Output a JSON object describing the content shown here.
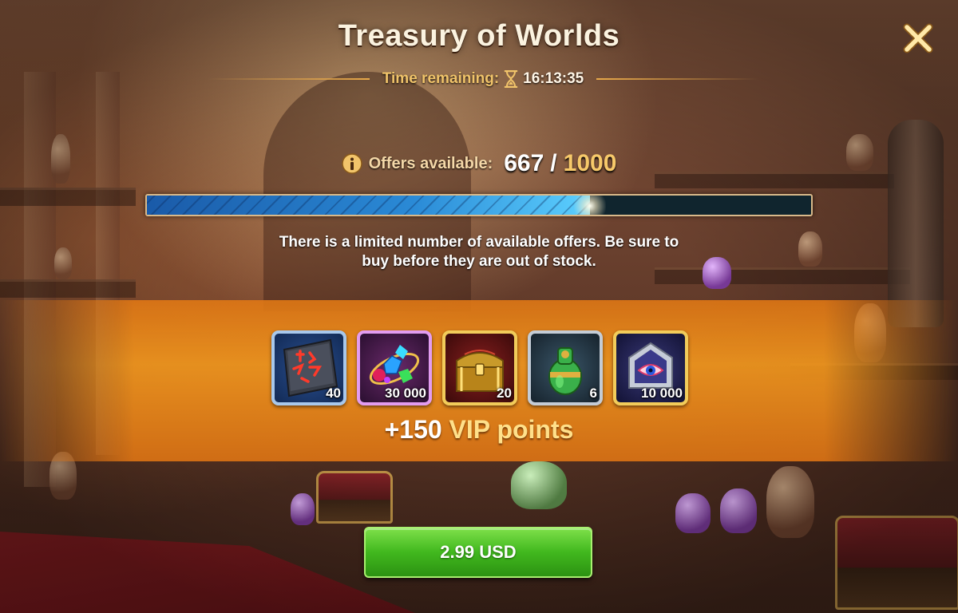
{
  "window": {
    "title": "Treasury of Worlds",
    "close_icon": "close-icon"
  },
  "timer": {
    "label": "Time remaining:",
    "icon": "hourglass-icon",
    "value": "16:13:35"
  },
  "offers": {
    "icon": "info-icon",
    "label": "Offers available:",
    "current": "667",
    "separator": "/",
    "total": "1000",
    "progress_fraction": 0.667,
    "notice": "There is a limited number of available offers. Be sure to buy before they are out of stock."
  },
  "rewards": [
    {
      "icon": "rune-tablet-icon",
      "quantity": "40",
      "frame": "blue"
    },
    {
      "icon": "gem-cluster-icon",
      "quantity": "30 000",
      "frame": "purple"
    },
    {
      "icon": "treasure-chest-icon",
      "quantity": "20",
      "frame": "gold"
    },
    {
      "icon": "green-armor-orb-icon",
      "quantity": "6",
      "frame": "silver"
    },
    {
      "icon": "eye-emblem-icon",
      "quantity": "10 000",
      "frame": "gold"
    }
  ],
  "vip": {
    "amount": "+150",
    "label": "VIP points"
  },
  "buy_button": {
    "label": "2.99 USD"
  },
  "colors": {
    "title_text": "#fbf3e0",
    "timer_label": "#f1c46a",
    "offers_total": "#f7c96a",
    "banner_orange": "#e8861c",
    "vip_label": "#ffe08a",
    "button_green": "#41b81e",
    "progress_blue": "#2a8ad6"
  }
}
